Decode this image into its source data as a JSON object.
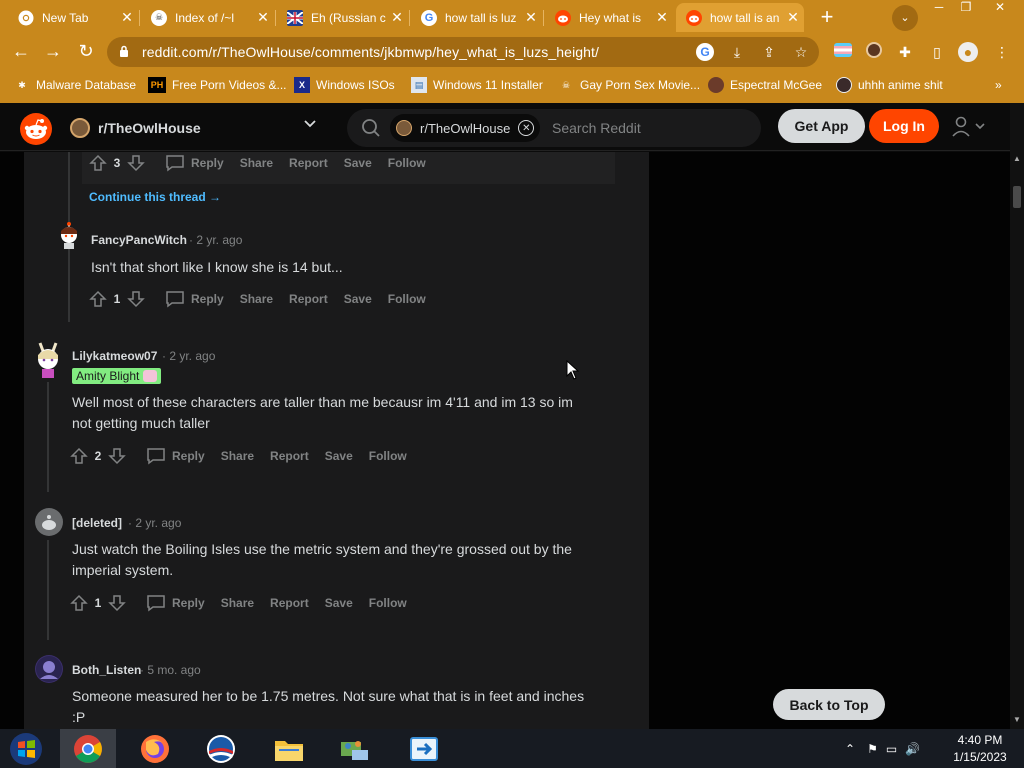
{
  "browser": {
    "tabs": [
      {
        "title": "New Tab",
        "icon": "chrome-icon"
      },
      {
        "title": "Index of /~l",
        "icon": "skull-icon"
      },
      {
        "title": "Eh (Russian c",
        "icon": "flag-icon"
      },
      {
        "title": "how tall is luz",
        "icon": "google-icon"
      },
      {
        "title": "Hey what is",
        "icon": "reddit-icon"
      },
      {
        "title": "how tall is an",
        "icon": "reddit-icon"
      }
    ],
    "url": "reddit.com/r/TheOwlHouse/comments/jkbmwp/hey_what_is_luzs_height/",
    "bookmarks": [
      {
        "label": "Malware Database"
      },
      {
        "label": "Free Porn Videos &...",
        "badge": "PH"
      },
      {
        "label": "Windows ISOs",
        "badge": "X"
      },
      {
        "label": "Windows 11 Installer"
      },
      {
        "label": "Gay Porn Sex Movie..."
      },
      {
        "label": "Espectral McGee"
      },
      {
        "label": "uhhh anime shit"
      }
    ],
    "window_controls": {
      "minimize": "─",
      "restore": "❐",
      "close": "✕"
    }
  },
  "reddit": {
    "community": "r/TheOwlHouse",
    "search_chip": "r/TheOwlHouse",
    "search_placeholder": "Search Reddit",
    "get_app": "Get App",
    "log_in": "Log In",
    "continue_thread": "Continue this thread →",
    "back_to_top": "Back to Top",
    "action_labels": {
      "reply": "Reply",
      "share": "Share",
      "report": "Report",
      "save": "Save",
      "follow": "Follow"
    },
    "top_actions": {
      "votes": "3"
    },
    "comments": [
      {
        "author": "FancyPancWitch",
        "age": "· 2 yr. ago",
        "body": "Isn't that short like I know she is 14 but...",
        "votes": "1"
      },
      {
        "author": "Lilykatmeow07",
        "age": "· 2 yr. ago",
        "flair": "Amity Blight",
        "body": "Well most of these characters are taller than me becausr im 4'11 and im 13 so im not getting much taller",
        "votes": "2"
      },
      {
        "author": "[deleted]",
        "age": "· 2 yr. ago",
        "body": "Just watch the Boiling Isles use the metric system and they're grossed out by the imperial system.",
        "votes": "1"
      },
      {
        "author": "Both_Listen",
        "age": "· 5 mo. ago",
        "body": "Someone measured her to be 1.75 metres. Not sure what that is in feet and inches :P"
      }
    ]
  },
  "taskbar": {
    "time": "4:40 PM",
    "date": "1/15/2023"
  },
  "colors": {
    "chrome_bg": "#c8881c",
    "reddit_orange": "#ff4500",
    "link_blue": "#4fbcff",
    "flair_green": "#82ec81"
  }
}
